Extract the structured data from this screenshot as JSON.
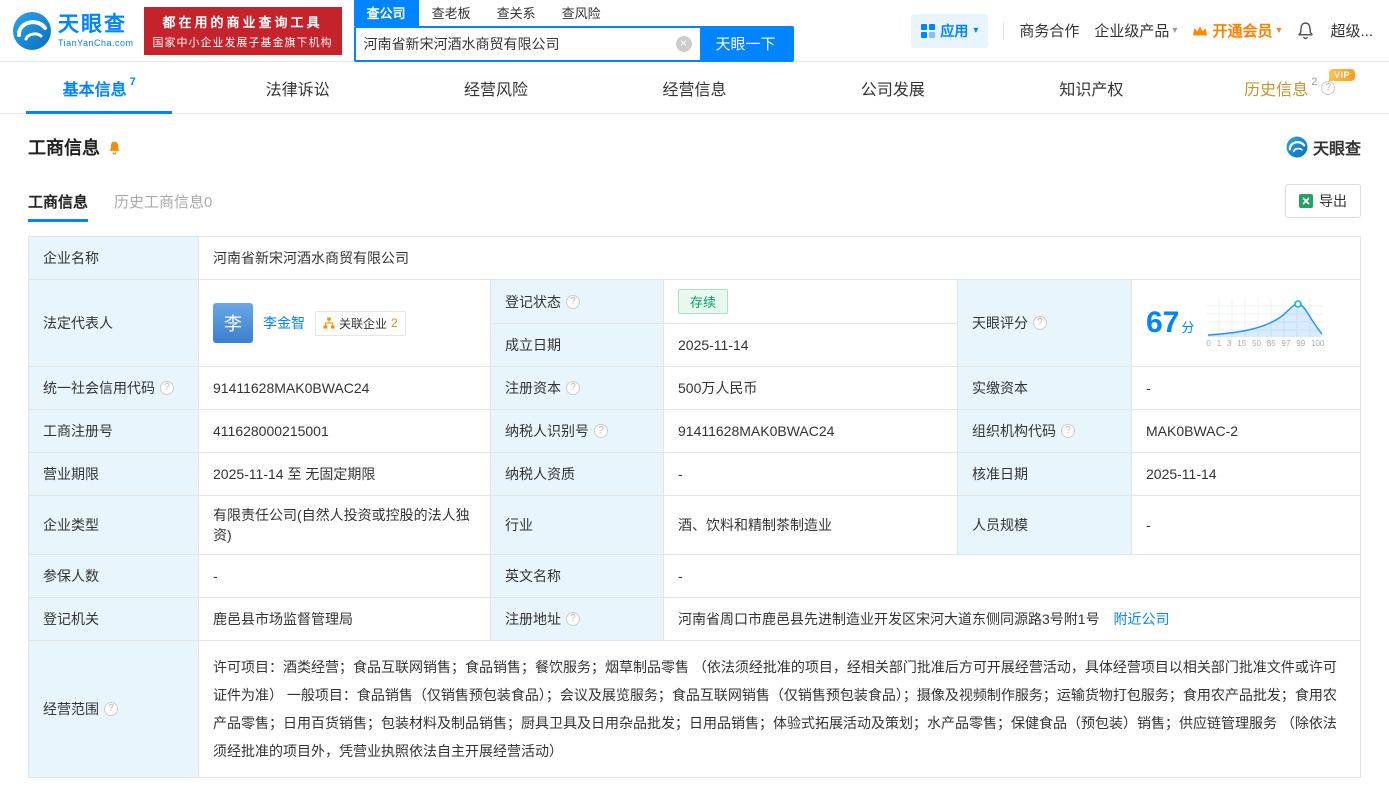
{
  "colors": {
    "brand_blue": "#0084ff",
    "promo_red": "#c5232c",
    "vip_orange": "#ff8a00",
    "status_green": "#00a664",
    "history_tab_orange": "#c9922f",
    "label_cell_bg": "#e9f5fd"
  },
  "icons": {
    "question": "?",
    "clear": "×",
    "caret_down": "▾"
  },
  "header": {
    "logo_title": "天眼查",
    "logo_domain": "TianYanCha.com",
    "promo_line1": "都在用的商业查询工具",
    "promo_line2": "国家中小企业发展子基金旗下机构",
    "search_tabs": [
      {
        "label": "查公司"
      },
      {
        "label": "查老板"
      },
      {
        "label": "查关系"
      },
      {
        "label": "查风险"
      }
    ],
    "search_value": "河南省新宋河酒水商贸有限公司",
    "search_button": "天眼一下",
    "apps_label": "应用",
    "biz_coop": "商务合作",
    "enterprise_product": "企业级产品",
    "open_vip": "开通会员",
    "super_vip": "超级..."
  },
  "nav_tabs": [
    {
      "label": "基本信息",
      "count": "7"
    },
    {
      "label": "法律诉讼",
      "count": ""
    },
    {
      "label": "经营风险",
      "count": ""
    },
    {
      "label": "经营信息",
      "count": ""
    },
    {
      "label": "公司发展",
      "count": ""
    },
    {
      "label": "知识产权",
      "count": ""
    },
    {
      "label": "历史信息",
      "count": "2",
      "badge": "VIP"
    }
  ],
  "section": {
    "title": "工商信息",
    "brand": "天眼查",
    "tab_current": "工商信息",
    "tab_history": "历史工商信息0",
    "export_label": "导出"
  },
  "table": {
    "labels": {
      "name": "企业名称",
      "legal_rep": "法定代表人",
      "reg_status": "登记状态",
      "establish_date": "成立日期",
      "score": "天眼评分",
      "credit_code": "统一社会信用代码",
      "reg_capital": "注册资本",
      "paid_capital": "实缴资本",
      "reg_number": "工商注册号",
      "taxpayer_id": "纳税人识别号",
      "org_code": "组织机构代码",
      "business_term": "营业期限",
      "taxpayer_quality": "纳税人资质",
      "approval_date": "核准日期",
      "company_type": "企业类型",
      "industry": "行业",
      "staff_size": "人员规模",
      "insured_count": "参保人数",
      "english_name": "英文名称",
      "reg_authority": "登记机关",
      "address": "注册地址",
      "business_scope": "经营范围"
    },
    "values": {
      "name": "河南省新宋河酒水商贸有限公司",
      "legal_rep_avatar": "李",
      "legal_rep_name": "李金智",
      "related_label": "关联企业",
      "related_count": "2",
      "reg_status": "存续",
      "establish_date": "2025-11-14",
      "score_value": "67",
      "score_unit": "分",
      "score_axis": [
        "0",
        "1",
        "3",
        "15",
        "50",
        "85",
        "97",
        "99",
        "100"
      ],
      "credit_code": "91411628MAK0BWAC24",
      "reg_capital": "500万人民币",
      "paid_capital": "-",
      "reg_number": "411628000215001",
      "taxpayer_id": "91411628MAK0BWAC24",
      "org_code": "MAK0BWAC-2",
      "business_term": "2025-11-14 至 无固定期限",
      "taxpayer_quality": "-",
      "approval_date": "2025-11-14",
      "company_type": "有限责任公司(自然人投资或控股的法人独资)",
      "industry": "酒、饮料和精制茶制造业",
      "staff_size": "-",
      "insured_count": "-",
      "english_name": "-",
      "reg_authority": "鹿邑县市场监督管理局",
      "address": "河南省周口市鹿邑县先进制造业开发区宋河大道东侧同源路3号附1号",
      "nearby_link": "附近公司",
      "business_scope": "许可项目：酒类经营；食品互联网销售；食品销售；餐饮服务；烟草制品零售 （依法须经批准的项目，经相关部门批准后方可开展经营活动，具体经营项目以相关部门批准文件或许可证件为准） 一般项目：食品销售（仅销售预包装食品）；会议及展览服务；食品互联网销售（仅销售预包装食品）；摄像及视频制作服务；运输货物打包服务；食用农产品批发；食用农产品零售；日用百货销售；包装材料及制品销售；厨具卫具及日用杂品批发；日用品销售；体验式拓展活动及策划；水产品零售；保健食品（预包装）销售；供应链管理服务 （除依法须经批准的项目外，凭营业执照依法自主开展经营活动）"
    }
  }
}
